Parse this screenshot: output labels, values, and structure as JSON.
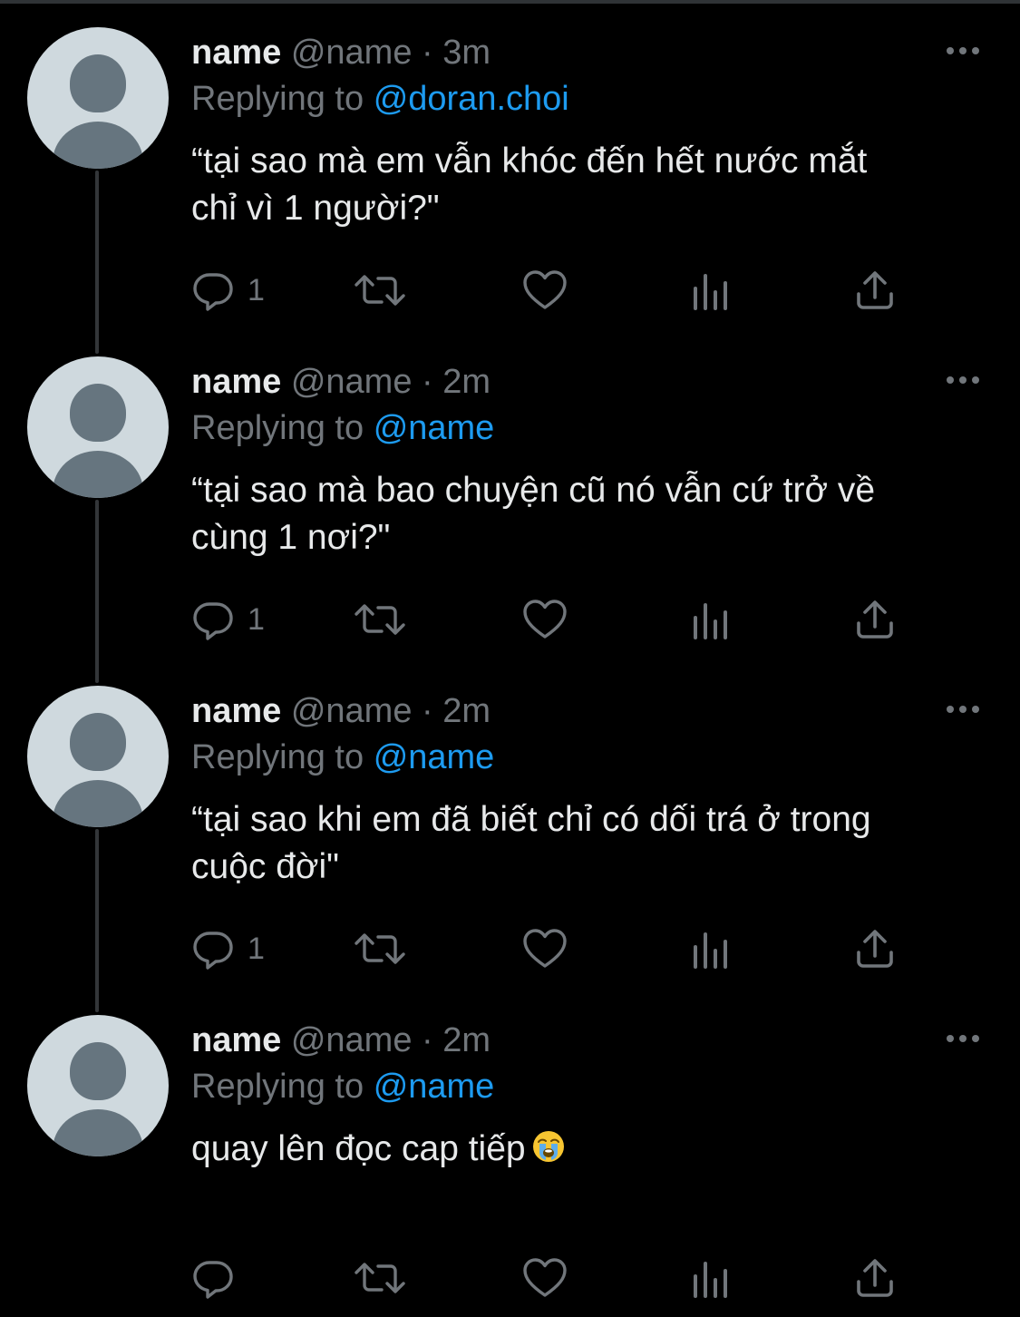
{
  "thread": {
    "tweets": [
      {
        "name": "name",
        "handle": "@name",
        "separator": "·",
        "time": "3m",
        "replying_prefix": "Replying to",
        "replying_to": "@doran.choi",
        "text": "“tại sao mà em vẫn khóc đến hết nước mắt\nchỉ vì 1 người?\"",
        "reply_count": "1"
      },
      {
        "name": "name",
        "handle": "@name",
        "separator": "·",
        "time": "2m",
        "replying_prefix": "Replying to",
        "replying_to": "@name",
        "text": "“tại sao mà bao chuyện cũ nó vẫn cứ trở về\ncùng 1 nơi?\"",
        "reply_count": "1"
      },
      {
        "name": "name",
        "handle": "@name",
        "separator": "·",
        "time": "2m",
        "replying_prefix": "Replying to",
        "replying_to": "@name",
        "text": "“tại sao khi em đã biết chỉ có dối trá ở trong\ncuộc đời\"",
        "reply_count": "1"
      },
      {
        "name": "name",
        "handle": "@name",
        "separator": "·",
        "time": "2m",
        "replying_prefix": "Replying to",
        "replying_to": "@name",
        "text": "quay lên đọc cap tiếp",
        "emoji": "loudly-crying-face-emoji",
        "reply_count": ""
      }
    ]
  },
  "icons": {
    "more": "more-horizontal-icon",
    "reply": "reply-icon",
    "retweet": "retweet-icon",
    "like": "heart-icon",
    "views": "views-icon",
    "share": "share-icon"
  },
  "colors": {
    "background": "#000000",
    "primary_text": "#e7e9ea",
    "secondary_text": "#71767b",
    "accent": "#1d9bf0",
    "thread_line": "#333639",
    "avatar_bg": "#cfd9de",
    "avatar_figure": "#66757f"
  }
}
